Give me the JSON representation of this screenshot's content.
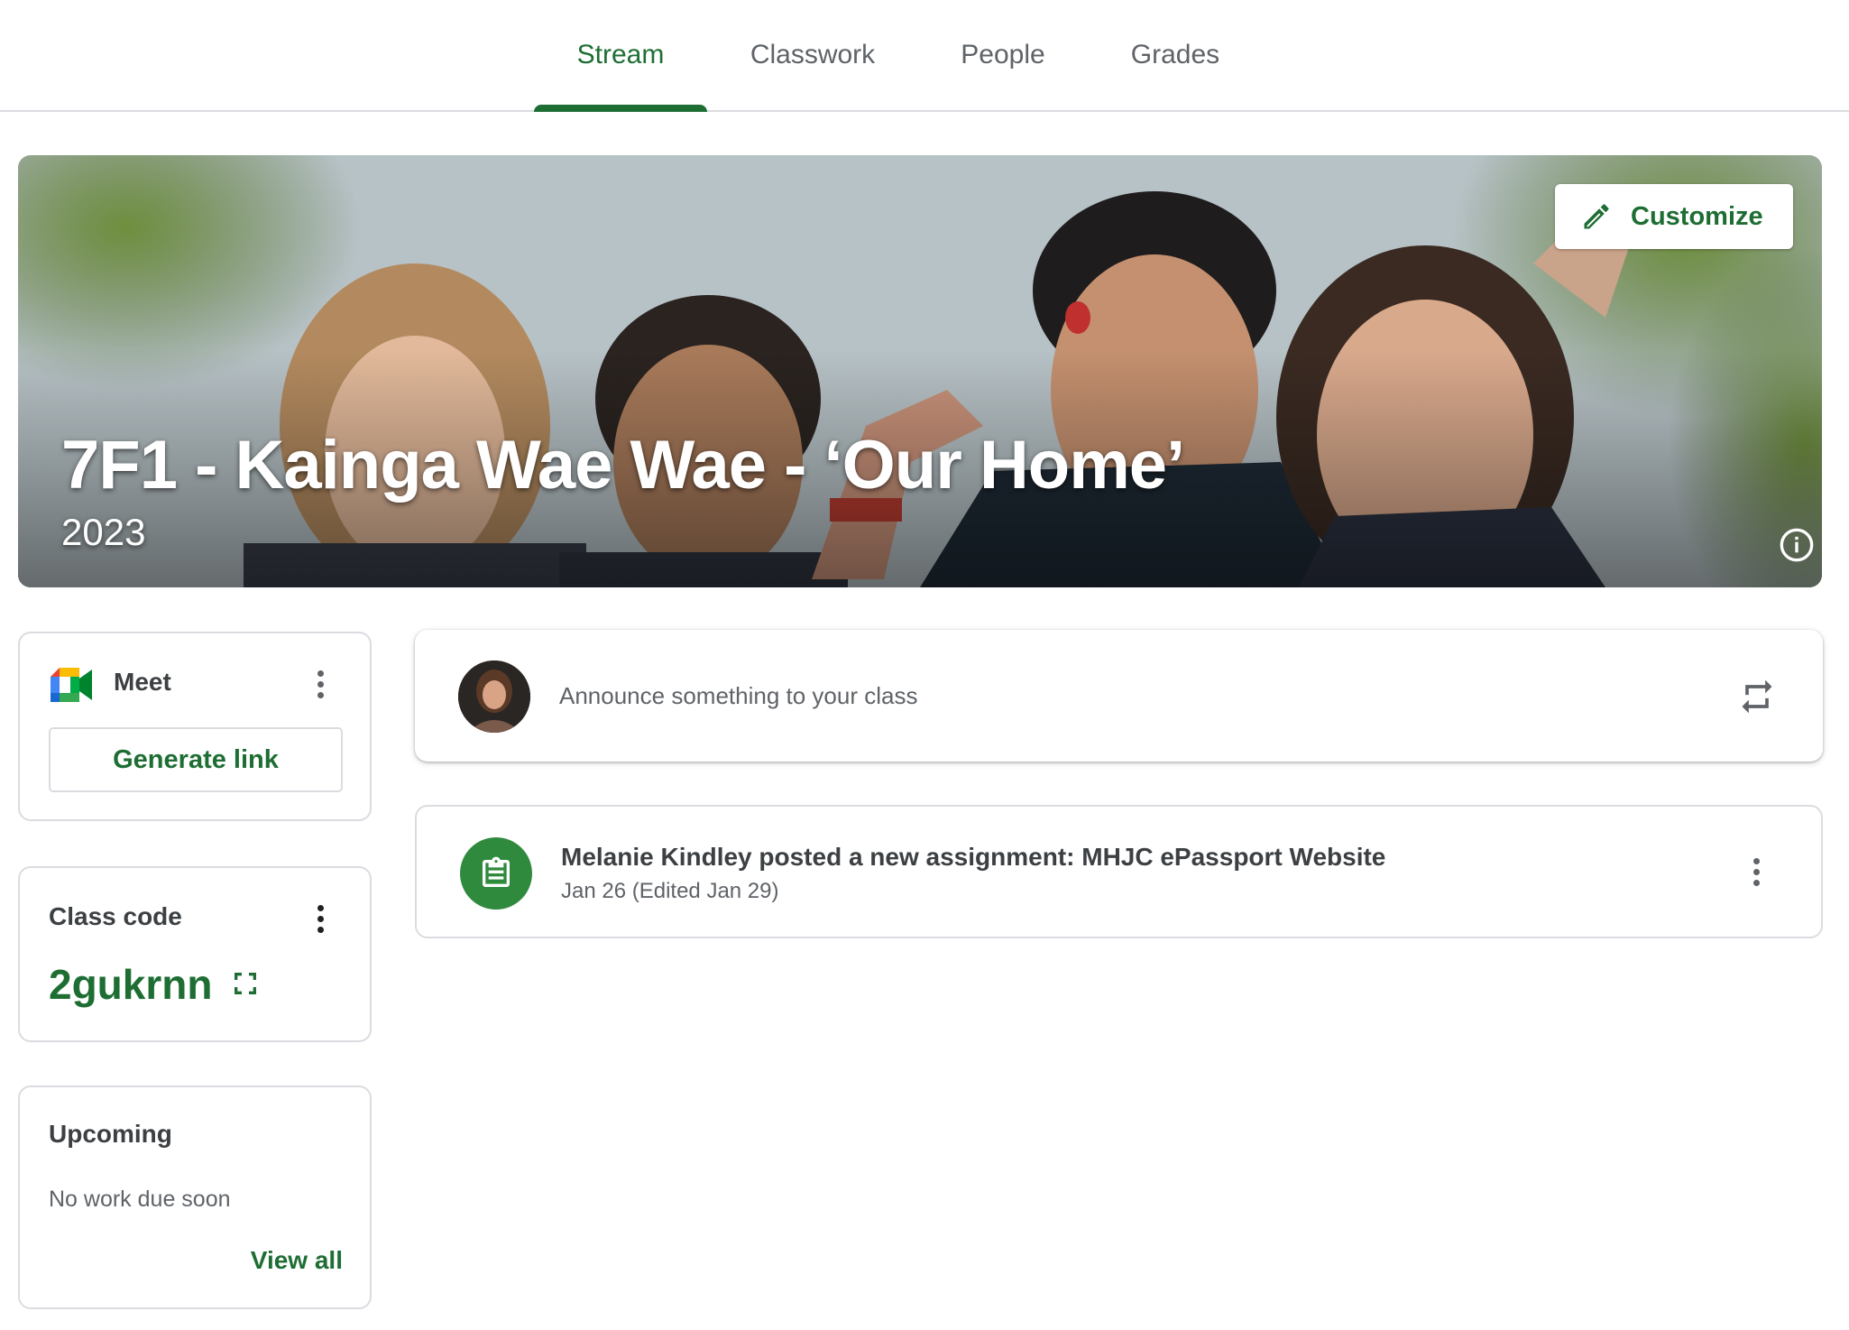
{
  "tabs": [
    {
      "label": "Stream",
      "active": true
    },
    {
      "label": "Classwork",
      "active": false
    },
    {
      "label": "People",
      "active": false
    },
    {
      "label": "Grades",
      "active": false
    }
  ],
  "banner": {
    "title": "7F1 - Kainga Wae Wae - ‘Our Home’",
    "section": "2023",
    "customize_label": "Customize"
  },
  "meet": {
    "label": "Meet",
    "generate_label": "Generate link"
  },
  "class_code": {
    "label": "Class code",
    "value": "2gukrnn"
  },
  "upcoming": {
    "label": "Upcoming",
    "empty_text": "No work due soon",
    "view_all": "View all"
  },
  "announce": {
    "placeholder": "Announce something to your class"
  },
  "posts": [
    {
      "title": "Melanie Kindley posted a new assignment: MHJC ePassport Website",
      "date": "Jan 26 (Edited Jan 29)"
    }
  ],
  "colors": {
    "accent": "#1e6e34",
    "assignment_icon_bg": "#2f8a3e",
    "border": "#dadce0"
  },
  "icons": [
    "pencil-icon",
    "info-icon",
    "meet-logo-icon",
    "more-vert-icon",
    "fullscreen-icon",
    "repost-icon",
    "assignment-icon"
  ]
}
